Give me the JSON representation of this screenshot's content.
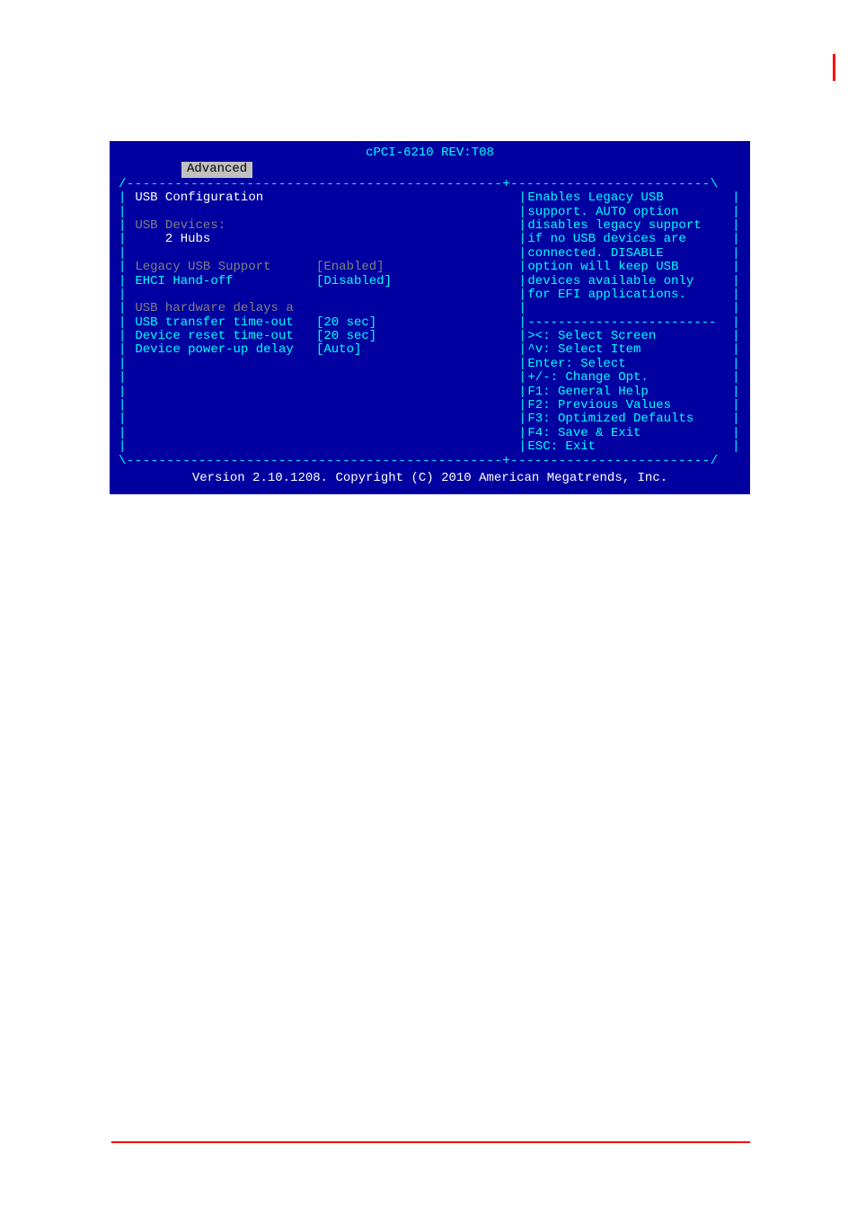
{
  "title": "cPCI-6210 REV:T08",
  "tab": "Advanced",
  "section_header": "USB Configuration",
  "usb_devices_label": "USB Devices:",
  "usb_devices_value": "    2 Hubs",
  "options": [
    {
      "label": "Legacy USB Support",
      "value": "[Enabled]",
      "style": "gray"
    },
    {
      "label": "EHCI Hand-off",
      "value": "[Disabled]",
      "style": "cyan"
    }
  ],
  "section2_label": "USB hardware delays a",
  "options2": [
    {
      "label": "USB transfer time-out",
      "value": "[20 sec]"
    },
    {
      "label": "Device reset time-out",
      "value": "[20 sec]"
    },
    {
      "label": "Device power-up delay",
      "value": "[Auto]"
    }
  ],
  "help_text": [
    "Enables Legacy USB",
    "support. AUTO option",
    "disables legacy support",
    "if no USB devices are",
    "connected. DISABLE",
    "option will keep USB",
    "devices available only",
    "for EFI applications."
  ],
  "nav_help": [
    "><: Select Screen",
    "^v: Select Item",
    "Enter: Select",
    "+/-: Change Opt.",
    "F1: General Help",
    "F2: Previous Values",
    "F3: Optimized Defaults",
    "F4: Save & Exit",
    "ESC: Exit"
  ],
  "footer": "Version 2.10.1208. Copyright (C) 2010 American Megatrends, Inc."
}
